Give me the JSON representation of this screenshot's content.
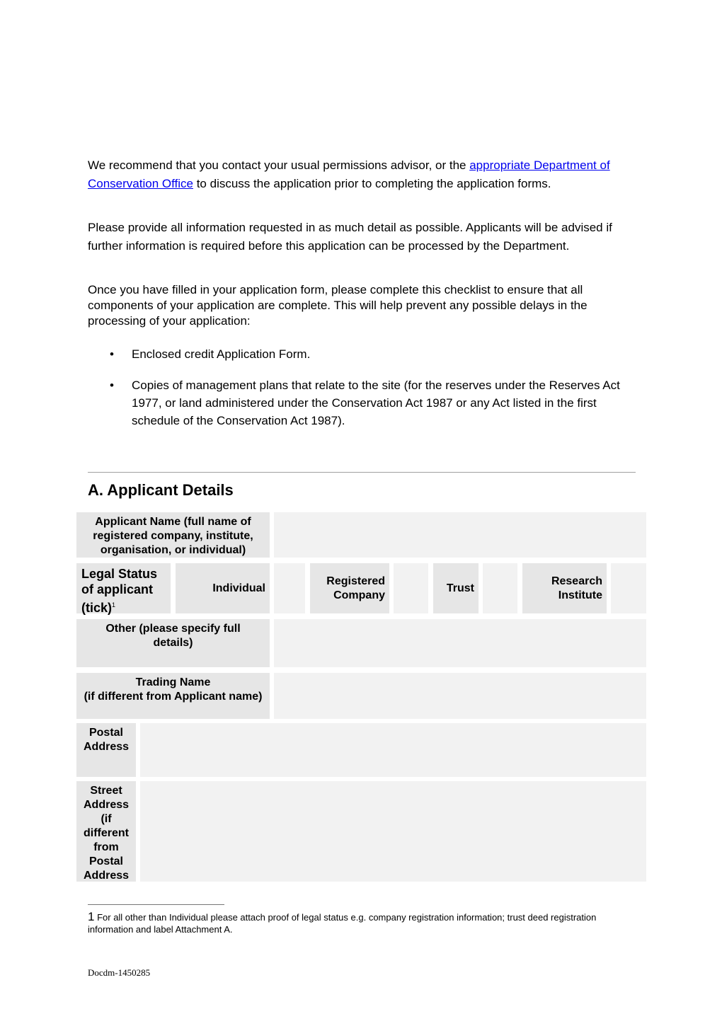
{
  "intro": {
    "p1_before": "We recommend that you contact your usual permissions advisor, or the ",
    "p1_link": "appropriate Department of Conservation Office",
    "p1_after": " to discuss the application prior to completing the application forms.",
    "p2": "Please provide all information requested in as much detail as possible.  Applicants will be advised if further information is required before this application can be processed by the Department.",
    "p3": "Once you have filled in your application form, please complete this checklist to ensure that all components of your application are complete.  This will help prevent any possible delays in the processing of your application:"
  },
  "checklist": [
    "Enclosed credit Application Form.",
    "Copies of management plans that relate to the site (for the reserves under the Reserves Act 1977, or land administered under the Conservation Act 1987 or any Act listed in the first schedule of the Conservation Act 1987)."
  ],
  "bullet_glyph": "•",
  "section": {
    "title": "A.  Applicant Details"
  },
  "form": {
    "applicant_name_label": "Applicant Name (full name of registered company, institute, organisation, or individual)",
    "legal_status_label": "Legal Status of applicant (tick)",
    "legal_status_footnote_ref": "1",
    "options": [
      "Individual",
      "Registered Company",
      "Trust",
      "Research Institute"
    ],
    "other_label": "Other (please specify full details)",
    "trading_name_label": "Trading Name\n(if different from Applicant name)",
    "postal_address_label": "Postal Address",
    "street_address_label": "Street Address (if different from Postal Address"
  },
  "footnote": {
    "number": "1",
    "text": " For all other than Individual please attach proof of legal status e.g. company registration information; trust deed registration information and label Attachment A."
  },
  "doc_id": "Docdm-1450285"
}
